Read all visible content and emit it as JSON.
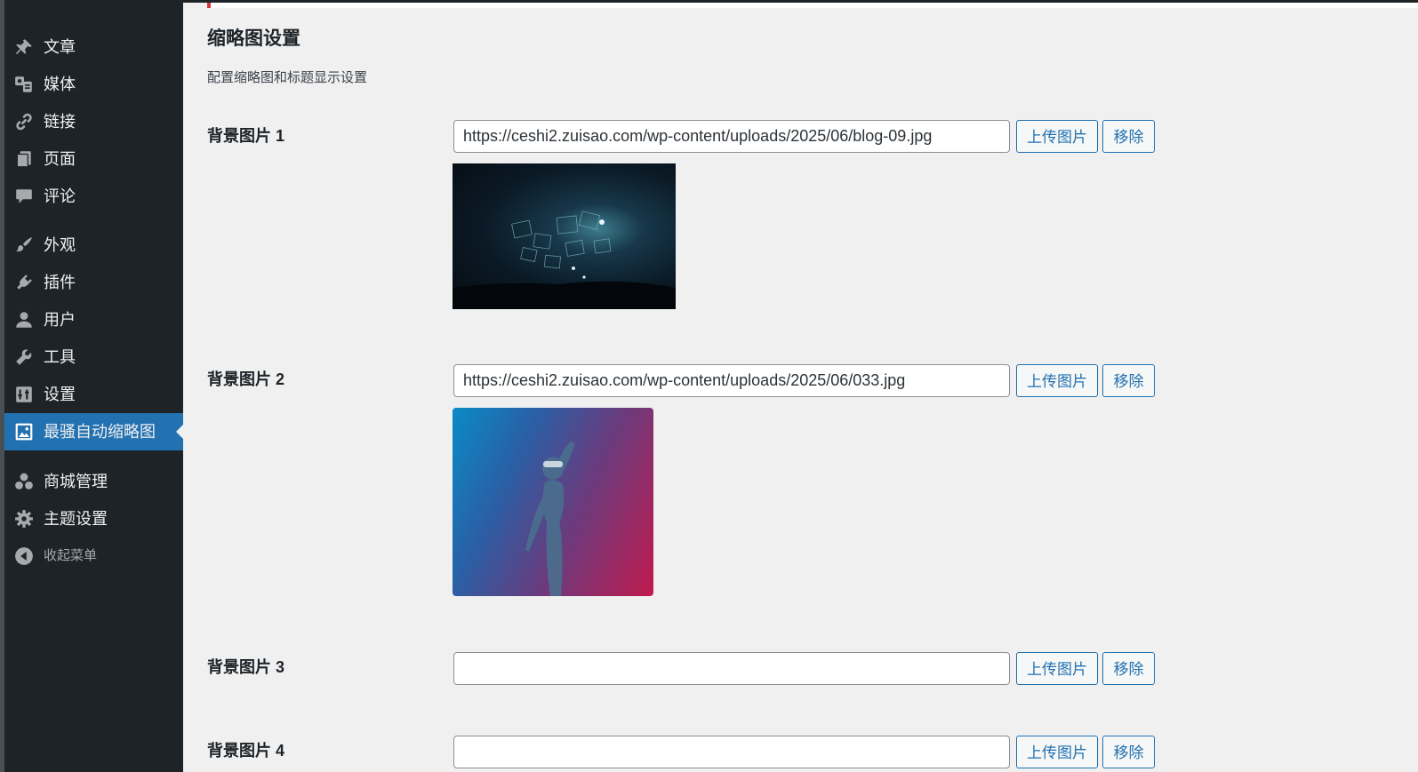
{
  "sidebar": {
    "items": [
      {
        "label": "文章",
        "icon": "pushpin-icon"
      },
      {
        "label": "媒体",
        "icon": "media-icon"
      },
      {
        "label": "链接",
        "icon": "link-icon"
      },
      {
        "label": "页面",
        "icon": "pages-icon"
      },
      {
        "label": "评论",
        "icon": "comment-icon"
      },
      {
        "label": "外观",
        "icon": "paintbrush-icon"
      },
      {
        "label": "插件",
        "icon": "plugin-icon"
      },
      {
        "label": "用户",
        "icon": "user-icon"
      },
      {
        "label": "工具",
        "icon": "wrench-icon"
      },
      {
        "label": "设置",
        "icon": "settings-icon"
      },
      {
        "label": "最骚自动缩略图",
        "icon": "image-icon",
        "active": true
      },
      {
        "label": "商城管理",
        "icon": "groups-icon"
      },
      {
        "label": "主题设置",
        "icon": "gear-icon"
      },
      {
        "label": "收起菜单",
        "icon": "collapse-icon"
      }
    ]
  },
  "main": {
    "title": "缩略图设置",
    "description": "配置缩略图和标题显示设置",
    "upload_label": "上传图片",
    "remove_label": "移除",
    "rows": [
      {
        "label": "背景图片 1",
        "value": "https://ceshi2.zuisao.com/wp-content/uploads/2025/06/blog-09.jpg"
      },
      {
        "label": "背景图片 2",
        "value": "https://ceshi2.zuisao.com/wp-content/uploads/2025/06/033.jpg"
      },
      {
        "label": "背景图片 3",
        "value": ""
      },
      {
        "label": "背景图片 4",
        "value": ""
      }
    ]
  },
  "colors": {
    "sidebar_bg": "#1d2327",
    "active_bg": "#2271b1",
    "page_bg": "#f0f0f1",
    "accent": "#2271b1"
  }
}
